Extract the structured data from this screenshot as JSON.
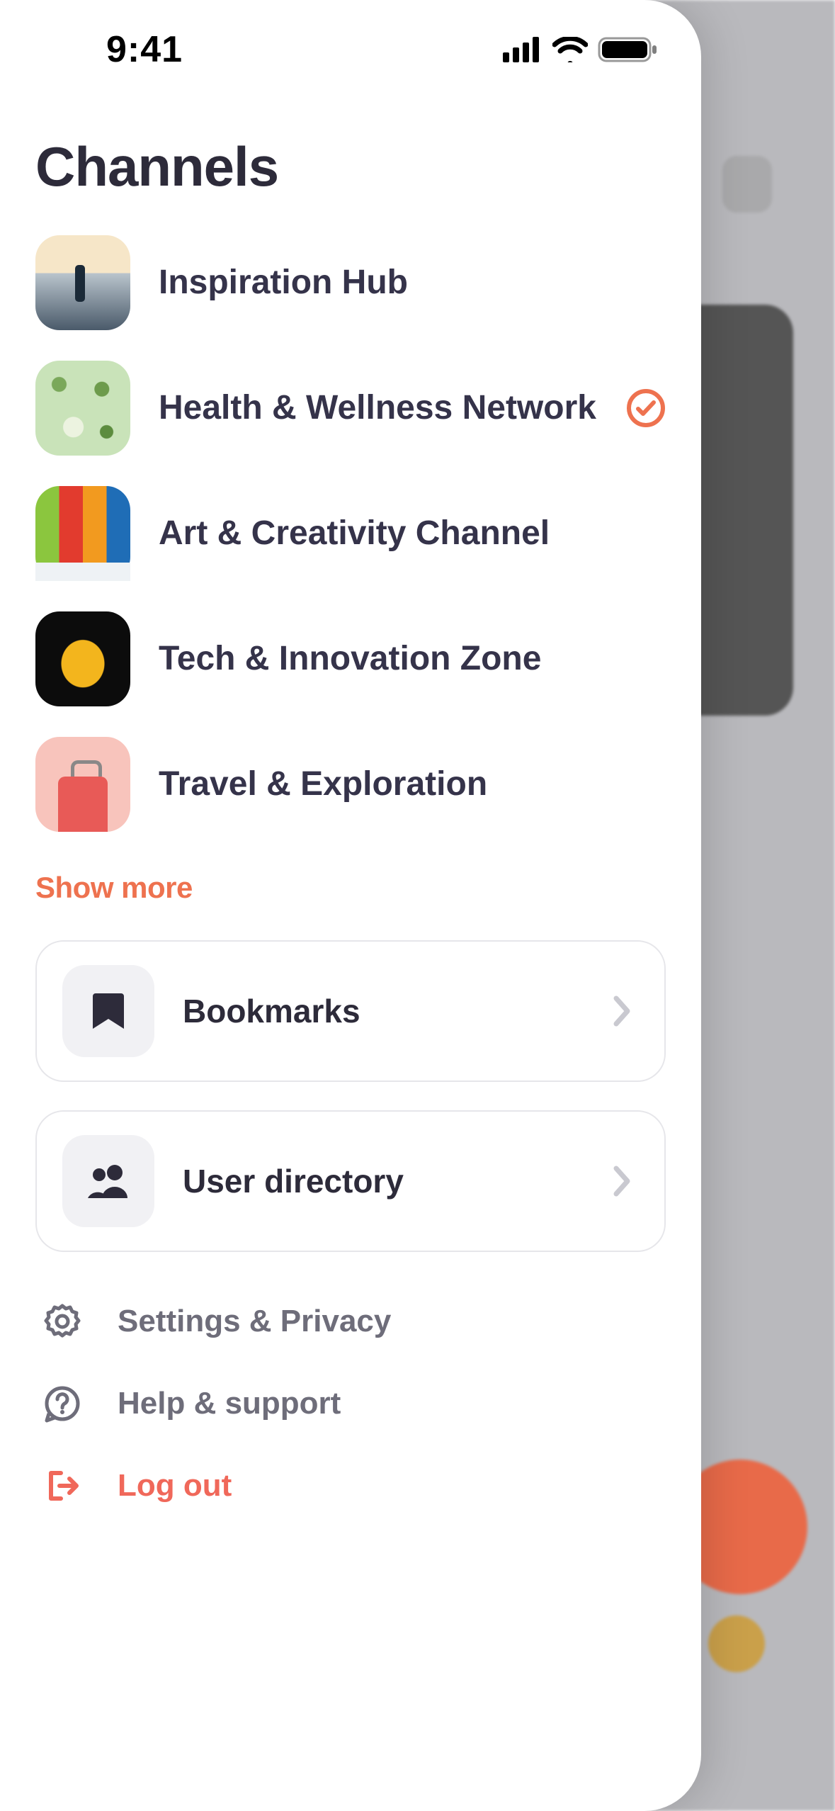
{
  "status": {
    "time": "9:41"
  },
  "title": "Channels",
  "channels": [
    {
      "label": "Inspiration Hub",
      "selected": false
    },
    {
      "label": "Health & Wellness Network",
      "selected": true
    },
    {
      "label": "Art & Creativity Channel",
      "selected": false
    },
    {
      "label": "Tech & Innovation Zone",
      "selected": false
    },
    {
      "label": "Travel & Exploration",
      "selected": false
    }
  ],
  "show_more": "Show more",
  "nav": {
    "bookmarks": "Bookmarks",
    "user_directory": "User directory"
  },
  "settings": {
    "settings_privacy": "Settings & Privacy",
    "help_support": "Help & support",
    "logout": "Log out"
  },
  "colors": {
    "accent": "#ee724f",
    "text_primary": "#2d2b3a",
    "text_secondary": "#6e6d7a",
    "danger": "#f0685a"
  }
}
